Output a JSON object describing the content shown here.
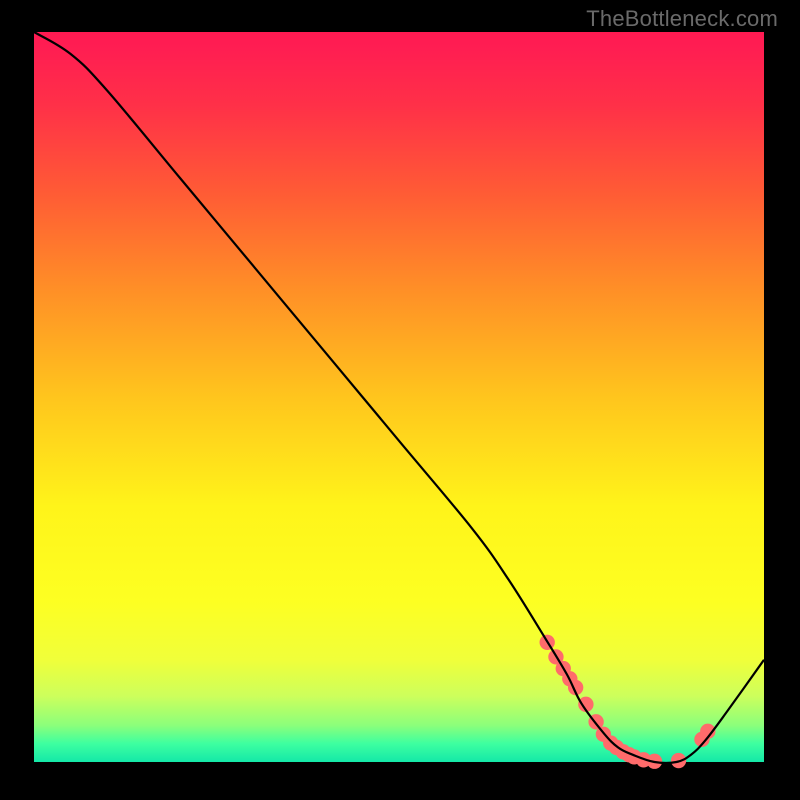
{
  "watermark": "TheBottleneck.com",
  "chart_data": {
    "type": "line",
    "title": "",
    "xlabel": "",
    "ylabel": "",
    "xlim": [
      0,
      100
    ],
    "ylim": [
      0,
      100
    ],
    "grid": false,
    "legend": false,
    "series": [
      {
        "name": "bottleneck-curve",
        "color": "#000000",
        "x": [
          0,
          5,
          10,
          20,
          30,
          40,
          50,
          60,
          65,
          70,
          73,
          75,
          78,
          80,
          82,
          85,
          88,
          90,
          92,
          95,
          100
        ],
        "y": [
          100,
          97,
          92,
          80,
          68,
          56,
          44,
          32,
          25,
          17,
          12,
          8,
          4,
          2,
          1,
          0,
          0,
          1,
          3,
          7,
          14
        ]
      }
    ],
    "highlight_points": {
      "name": "marker-dots",
      "color": "#ff6b6b",
      "x": [
        70.3,
        71.5,
        72.5,
        73.4,
        74.2,
        75.6,
        77.0,
        78.0,
        79.0,
        79.8,
        80.7,
        81.5,
        82.2,
        83.5,
        85.0,
        88.3,
        91.5,
        92.3
      ],
      "y": [
        16.4,
        14.4,
        12.8,
        11.4,
        10.2,
        7.9,
        5.5,
        3.8,
        2.6,
        2.0,
        1.4,
        1.0,
        0.7,
        0.3,
        0.1,
        0.2,
        3.1,
        4.2
      ]
    },
    "background_gradient": {
      "stops": [
        {
          "offset": 0.0,
          "color": "#ff1a52"
        },
        {
          "offset": 0.02,
          "color": "#ff1d52"
        },
        {
          "offset": 0.1,
          "color": "#ff3048"
        },
        {
          "offset": 0.22,
          "color": "#ff5b35"
        },
        {
          "offset": 0.35,
          "color": "#ff8e27"
        },
        {
          "offset": 0.5,
          "color": "#ffc51d"
        },
        {
          "offset": 0.65,
          "color": "#fff41a"
        },
        {
          "offset": 0.78,
          "color": "#fdff22"
        },
        {
          "offset": 0.86,
          "color": "#f0ff3a"
        },
        {
          "offset": 0.91,
          "color": "#ccff5c"
        },
        {
          "offset": 0.95,
          "color": "#8bff7b"
        },
        {
          "offset": 0.975,
          "color": "#3dffa0"
        },
        {
          "offset": 1.0,
          "color": "#14e8a8"
        }
      ]
    }
  }
}
